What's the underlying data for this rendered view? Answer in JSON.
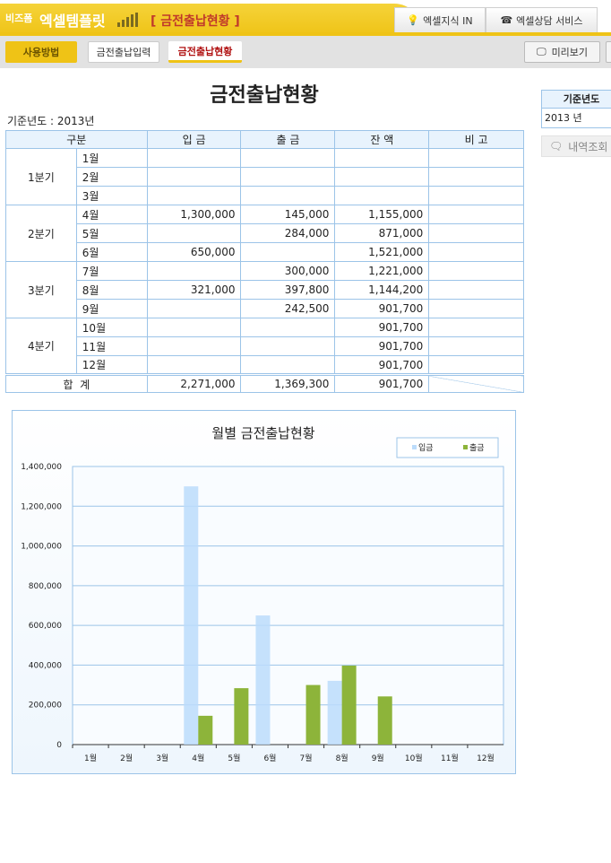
{
  "header": {
    "logo_small": "비즈폼",
    "logo_main": "엑셀템플릿",
    "app_title": "[ 금전출납현황 ]",
    "tab_knowledge": "엑셀지식 IN",
    "tab_consult": "엑셀상담 서비스"
  },
  "toolbar": {
    "howto": "사용방법",
    "input": "금전출납입력",
    "status": "금전출납현황",
    "preview": "미리보기"
  },
  "page": {
    "title": "금전출납현황",
    "year_label": "기준년도 : 2013년"
  },
  "side": {
    "header": "기준년도",
    "value": "2013 년",
    "query": "내역조회"
  },
  "table": {
    "headers": [
      "구분",
      "입 금",
      "출 금",
      "잔 액",
      "비 고"
    ],
    "quarters": [
      "1분기",
      "2분기",
      "3분기",
      "4분기"
    ],
    "rows": [
      {
        "m": "1월",
        "in": "",
        "out": "",
        "bal": ""
      },
      {
        "m": "2월",
        "in": "",
        "out": "",
        "bal": ""
      },
      {
        "m": "3월",
        "in": "",
        "out": "",
        "bal": ""
      },
      {
        "m": "4월",
        "in": "1,300,000",
        "out": "145,000",
        "bal": "1,155,000"
      },
      {
        "m": "5월",
        "in": "",
        "out": "284,000",
        "bal": "871,000"
      },
      {
        "m": "6월",
        "in": "650,000",
        "out": "",
        "bal": "1,521,000"
      },
      {
        "m": "7월",
        "in": "",
        "out": "300,000",
        "bal": "1,221,000"
      },
      {
        "m": "8월",
        "in": "321,000",
        "out": "397,800",
        "bal": "1,144,200"
      },
      {
        "m": "9월",
        "in": "",
        "out": "242,500",
        "bal": "901,700"
      },
      {
        "m": "10월",
        "in": "",
        "out": "",
        "bal": "901,700"
      },
      {
        "m": "11월",
        "in": "",
        "out": "",
        "bal": "901,700"
      },
      {
        "m": "12월",
        "in": "",
        "out": "",
        "bal": "901,700"
      }
    ],
    "total": {
      "label": "합  계",
      "in": "2,271,000",
      "out": "1,369,300",
      "bal": "901,700"
    }
  },
  "chart_data": {
    "type": "bar",
    "title": "월별 금전출납현황",
    "categories": [
      "1월",
      "2월",
      "3월",
      "4월",
      "5월",
      "6월",
      "7월",
      "8월",
      "9월",
      "10월",
      "11월",
      "12월"
    ],
    "series": [
      {
        "name": "입금",
        "color": "#bcdcfb",
        "values": [
          0,
          0,
          0,
          1300000,
          0,
          650000,
          0,
          321000,
          0,
          0,
          0,
          0
        ]
      },
      {
        "name": "출금",
        "color": "#8db43a",
        "values": [
          0,
          0,
          0,
          145000,
          284000,
          0,
          300000,
          397800,
          242500,
          0,
          0,
          0
        ]
      }
    ],
    "yticks": [
      "0",
      "200,000",
      "400,000",
      "600,000",
      "800,000",
      "1,000,000",
      "1,200,000",
      "1,400,000"
    ],
    "ylim": [
      0,
      1400000
    ],
    "legend": "top-right",
    "grid": true
  }
}
